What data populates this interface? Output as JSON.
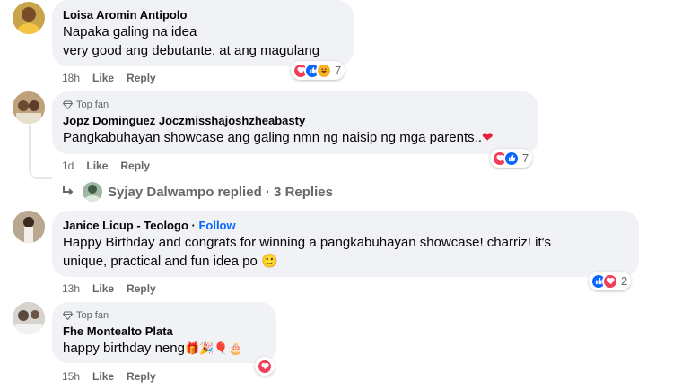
{
  "comments": [
    {
      "author": "Loisa Aromin Antipolo",
      "lines": [
        "Napaka galing na idea",
        "very good ang debutante, at ang magulang"
      ],
      "time": "18h",
      "like": "Like",
      "reply": "Reply",
      "reaction_count": "7",
      "reactions": [
        "heart",
        "like",
        "haha"
      ]
    },
    {
      "badge": "Top fan",
      "author": "Jopz Dominguez Joczmisshajoshzheabasty",
      "text": "Pangkabuhayan showcase ang galing nmn ng naisip ng mga parents..",
      "emoji": "❤",
      "time": "1d",
      "like": "Like",
      "reply": "Reply",
      "reaction_count": "7",
      "reactions": [
        "heart",
        "like"
      ],
      "replies_text": "Syjay Dalwampo replied · 3 Replies"
    },
    {
      "author": "Janice Licup - Teologo",
      "follow_sep": " · ",
      "follow": "Follow",
      "lines": [
        "Happy Birthday and congrats for winning a pangkabuhayan showcase! charriz! it's",
        "unique, practical and fun idea po"
      ],
      "emoji": "🙂",
      "time": "13h",
      "like": "Like",
      "reply": "Reply",
      "reaction_count": "2",
      "reactions": [
        "like",
        "heart"
      ]
    },
    {
      "badge": "Top fan",
      "author": "Fhe Montealto Plata",
      "text": "happy birthday neng",
      "emojis": "🎁🎉🎈🎂",
      "time": "15h",
      "like": "Like",
      "reply": "Reply",
      "reactions": [
        "heart"
      ]
    }
  ],
  "colors": {
    "like": "#0866ff",
    "heart": "#f33e58",
    "haha": "#f7b125",
    "bubble": "#f0f2f5",
    "meta": "#65676b"
  }
}
